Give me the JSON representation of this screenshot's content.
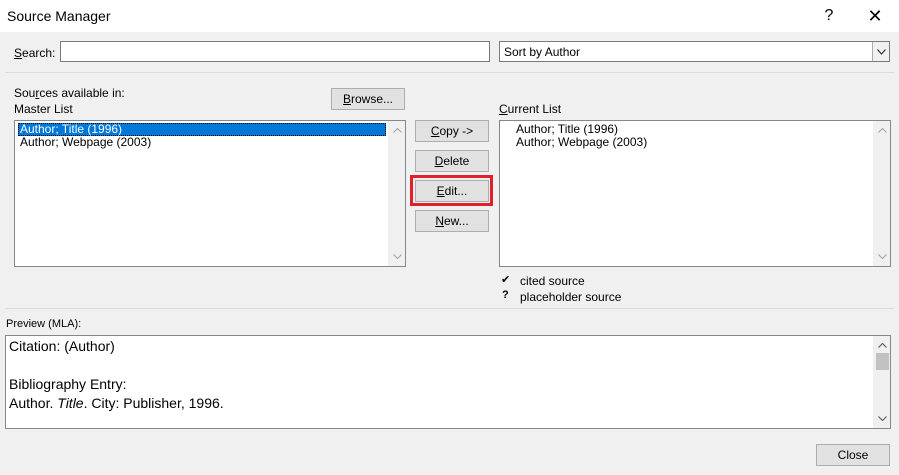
{
  "window": {
    "title": "Source Manager"
  },
  "titlebar": {
    "help_glyph": "?",
    "close_glyph": "✕"
  },
  "search": {
    "label_prefix": "",
    "label_hotkey": "S",
    "label_rest": "earch:",
    "value": "",
    "placeholder": ""
  },
  "sort": {
    "selected": "Sort by Author",
    "arrow_glyph": "⌄"
  },
  "sources_available": {
    "label_a": "Sou",
    "label_hotkey": "r",
    "label_b": "ces available in:"
  },
  "master_list": {
    "label": "Master List",
    "items": [
      "Author; Title (1996)",
      "Author; Webpage (2003)"
    ],
    "selected_index": 0
  },
  "browse_button": {
    "hotkey": "B",
    "rest": "rowse..."
  },
  "buttons": {
    "copy": {
      "hotkey": "C",
      "rest": "opy ->"
    },
    "delete": {
      "hotkey": "D",
      "rest": "elete"
    },
    "edit": {
      "hotkey": "E",
      "rest": "dit..."
    },
    "new": {
      "hotkey": "N",
      "rest": "ew..."
    }
  },
  "current_list": {
    "label_hotkey": "C",
    "label_rest": "urrent List",
    "items": [
      "Author; Title (1996)",
      "Author; Webpage (2003)"
    ]
  },
  "legend": {
    "cited_glyph": "✔",
    "cited_label": "cited source",
    "placeholder_glyph": "?",
    "placeholder_label": "placeholder source"
  },
  "preview": {
    "label": "Preview (MLA):",
    "citation": "Citation:  (Author)",
    "bib_label": "Bibliography Entry:",
    "bib_author": "Author. ",
    "bib_title": "Title",
    "bib_rest": ". City: Publisher, 1996."
  },
  "close_button": {
    "label": "Close"
  },
  "colors": {
    "selection": "#0078d7",
    "highlight": "#e0202a",
    "dialog_bg": "#f0f0f0"
  }
}
